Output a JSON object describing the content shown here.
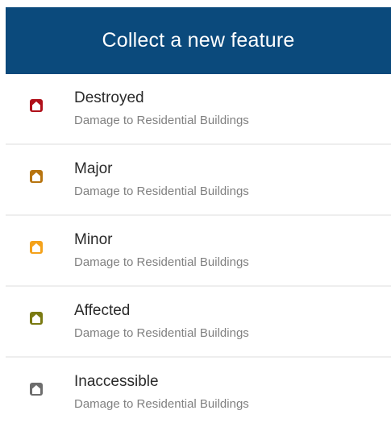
{
  "header": {
    "title": "Collect a new feature"
  },
  "items": [
    {
      "label": "Destroyed",
      "type": "Damage to Residential Buildings",
      "icon": "house-destroyed-icon",
      "color": "#b0101a"
    },
    {
      "label": "Major",
      "type": "Damage to Residential Buildings",
      "icon": "house-major-icon",
      "color": "#b7740f"
    },
    {
      "label": "Minor",
      "type": "Damage to Residential Buildings",
      "icon": "house-minor-icon",
      "color": "#f4a21b"
    },
    {
      "label": "Affected",
      "type": "Damage to Residential Buildings",
      "icon": "house-affected-icon",
      "color": "#7a7a12"
    },
    {
      "label": "Inaccessible",
      "type": "Damage to Residential Buildings",
      "icon": "house-inaccessible-icon",
      "color": "#6d6d6d"
    }
  ]
}
